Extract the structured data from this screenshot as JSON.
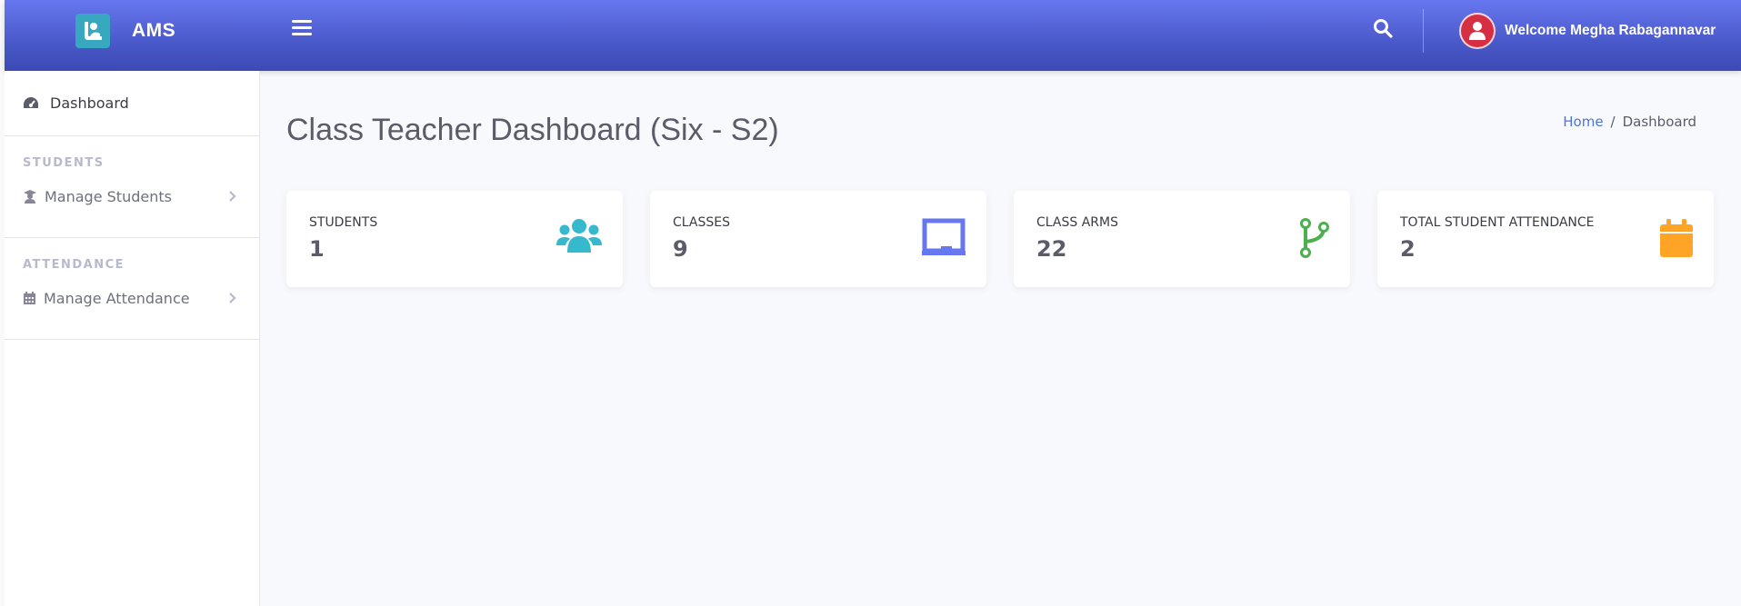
{
  "header": {
    "brand": "AMS",
    "welcome": "Welcome Megha Rabagannavar"
  },
  "sidebar": {
    "dashboard_label": "Dashboard",
    "sections": [
      {
        "heading": "STUDENTS",
        "item": "Manage Students"
      },
      {
        "heading": "ATTENDANCE",
        "item": "Manage Attendance"
      }
    ]
  },
  "main": {
    "title": "Class Teacher Dashboard (Six - S2)",
    "breadcrumb": {
      "home": "Home",
      "separator": "/",
      "current": "Dashboard"
    },
    "cards": [
      {
        "title": "STUDENTS",
        "value": "1",
        "icon": "users-icon",
        "color": "#36b9cc"
      },
      {
        "title": "CLASSES",
        "value": "9",
        "icon": "chalkboard-icon",
        "color": "#6777ef"
      },
      {
        "title": "CLASS ARMS",
        "value": "22",
        "icon": "code-branch-icon",
        "color": "#4caf50"
      },
      {
        "title": "TOTAL STUDENT ATTENDANCE",
        "value": "2",
        "icon": "calendar-icon",
        "color": "#ffa426"
      }
    ]
  }
}
